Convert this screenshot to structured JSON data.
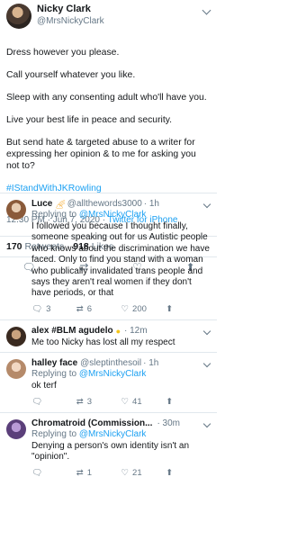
{
  "tweet": {
    "display_name": "Nicky Clark",
    "handle": "@MrsNickyClark",
    "lines": [
      "Dress however you please.",
      "Call yourself whatever you like.",
      "Sleep with any consenting adult who'll have you.",
      "Live your best life in peace and security.",
      "But send hate & targeted abuse to a writer for expressing her opinion & to me for asking you not to?"
    ],
    "hashtag": "#IStandWithJKRowling",
    "time": "12:30 PM · Jun 7, 2020 · ",
    "source": "Twitter for iPhone",
    "retweets_count": "170",
    "retweets_label": "Retweets",
    "likes_count": "918",
    "likes_label": "Likes"
  },
  "icons": {
    "reply": "reply-icon",
    "retweet": "retweet-icon",
    "like": "heart-icon",
    "share": "share-icon",
    "more": "chevron-down-icon"
  },
  "replies": [
    {
      "name": "Luce",
      "handle": "@allthewords3000",
      "time": "· 1h",
      "replying_prefix": "Replying to ",
      "replying_to": "@MrsNickyClark",
      "text": "I followed you because I thought finally, someone speaking out for us Autistic people who knows about the discrimination we have faced. Only to find you stand with a woman who publically invalidated trans people and says they aren't real women if they don't have periods, or that",
      "reply_count": "3",
      "retweet_count": "6",
      "like_count": "200"
    },
    {
      "name": "alex #BLM agudelo",
      "handle": "",
      "time": "· 12m",
      "replying_prefix": "",
      "replying_to": "",
      "text": "Me too Nicky has lost all my respect",
      "reply_count": "",
      "retweet_count": "",
      "like_count": ""
    },
    {
      "name": "halley face",
      "handle": "@sleptinthesoil",
      "time": "· 1h",
      "replying_prefix": "Replying to ",
      "replying_to": "@MrsNickyClark",
      "text": "ok terf",
      "reply_count": "",
      "retweet_count": "3",
      "like_count": "41"
    },
    {
      "name": "Chromatroid (Commission...",
      "handle": "",
      "time": "· 30m",
      "replying_prefix": "Replying to ",
      "replying_to": "@MrsNickyClark",
      "text": "Denying a person's own identity isn't an \"opinion\".",
      "reply_count": "",
      "retweet_count": "1",
      "like_count": "21"
    }
  ],
  "colors": {
    "accent": "#1da1f2",
    "muted": "#657786",
    "border": "#e1e8ed"
  }
}
